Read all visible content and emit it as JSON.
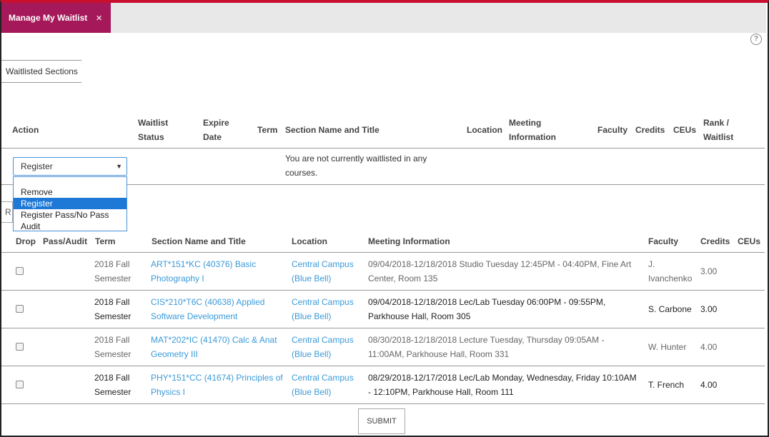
{
  "window": {
    "tab_title": "Manage My Waitlist",
    "close_glyph": "×",
    "help_glyph": "?"
  },
  "subtab": {
    "label": "Waitlisted Sections"
  },
  "waitlist_table": {
    "headers": {
      "action": "Action",
      "waitlist_status_1": "Waitlist",
      "waitlist_status_2": "Status",
      "expire_1": "Expire",
      "expire_2": "Date",
      "term": "Term",
      "section": "Section Name and Title",
      "location": "Location",
      "meeting_1": "Meeting",
      "meeting_2": "Information",
      "faculty": "Faculty",
      "credits": "Credits",
      "ceus": "CEUs",
      "rank_1": "Rank /",
      "rank_2": "Waitlist"
    },
    "empty_message_1": "You are not currently waitlisted in any",
    "empty_message_2": "courses."
  },
  "action_select": {
    "value": "Register",
    "options": [
      "Remove",
      "Register",
      "Register Pass/No Pass",
      "Audit"
    ],
    "selected_index": 1,
    "behind_text": "R"
  },
  "courses_table": {
    "headers": {
      "drop": "Drop",
      "pass_audit": "Pass/Audit",
      "term": "Term",
      "section": "Section Name and Title",
      "location": "Location",
      "meeting": "Meeting Information",
      "faculty": "Faculty",
      "credits": "Credits",
      "ceus": "CEUs"
    },
    "rows": [
      {
        "term_1": "2018 Fall",
        "term_2": "Semester",
        "section_1": "ART*151*KC (40376) Basic",
        "section_2": "Photography I",
        "location_1": "Central Campus",
        "location_2": "(Blue Bell)",
        "meeting_1": "09/04/2018-12/18/2018 Studio Tuesday 12:45PM - 04:40PM, Fine Art",
        "meeting_2": "Center, Room 135",
        "faculty_1": "J.",
        "faculty_2": "Ivanchenko",
        "credits": "3.00",
        "muted": true
      },
      {
        "term_1": "2018 Fall",
        "term_2": "Semester",
        "section_1": "CIS*210*T6C (40638) Applied",
        "section_2": "Software Development",
        "location_1": "Central Campus",
        "location_2": "(Blue Bell)",
        "meeting_1": "09/04/2018-12/18/2018 Lec/Lab Tuesday 06:00PM - 09:55PM,",
        "meeting_2": "Parkhouse Hall, Room 305",
        "faculty_1": "S. Carbone",
        "faculty_2": "",
        "credits": "3.00",
        "muted": false
      },
      {
        "term_1": "2018 Fall",
        "term_2": "Semester",
        "section_1": "MAT*202*IC (41470) Calc & Anat",
        "section_2": "Geometry III",
        "location_1": "Central Campus",
        "location_2": "(Blue Bell)",
        "meeting_1": "08/30/2018-12/18/2018 Lecture Tuesday, Thursday 09:05AM -",
        "meeting_2": "11:00AM, Parkhouse Hall, Room 331",
        "faculty_1": "W. Hunter",
        "faculty_2": "",
        "credits": "4.00",
        "muted": true
      },
      {
        "term_1": "2018 Fall",
        "term_2": "Semester",
        "section_1": "PHY*151*CC (41674) Principles of",
        "section_2": "Physics I",
        "location_1": "Central Campus",
        "location_2": "(Blue Bell)",
        "meeting_1": "08/29/2018-12/17/2018 Lec/Lab Monday, Wednesday, Friday 10:10AM",
        "meeting_2": "- 12:10PM, Parkhouse Hall, Room 111",
        "faculty_1": "T. French",
        "faculty_2": "",
        "credits": "4.00",
        "muted": false
      }
    ]
  },
  "submit": {
    "label": "SUBMIT"
  },
  "colors": {
    "accent_tab": "#a5195a",
    "top_border": "#c8102e",
    "link": "#3a9ad9",
    "selected_option": "#1e78d6"
  }
}
